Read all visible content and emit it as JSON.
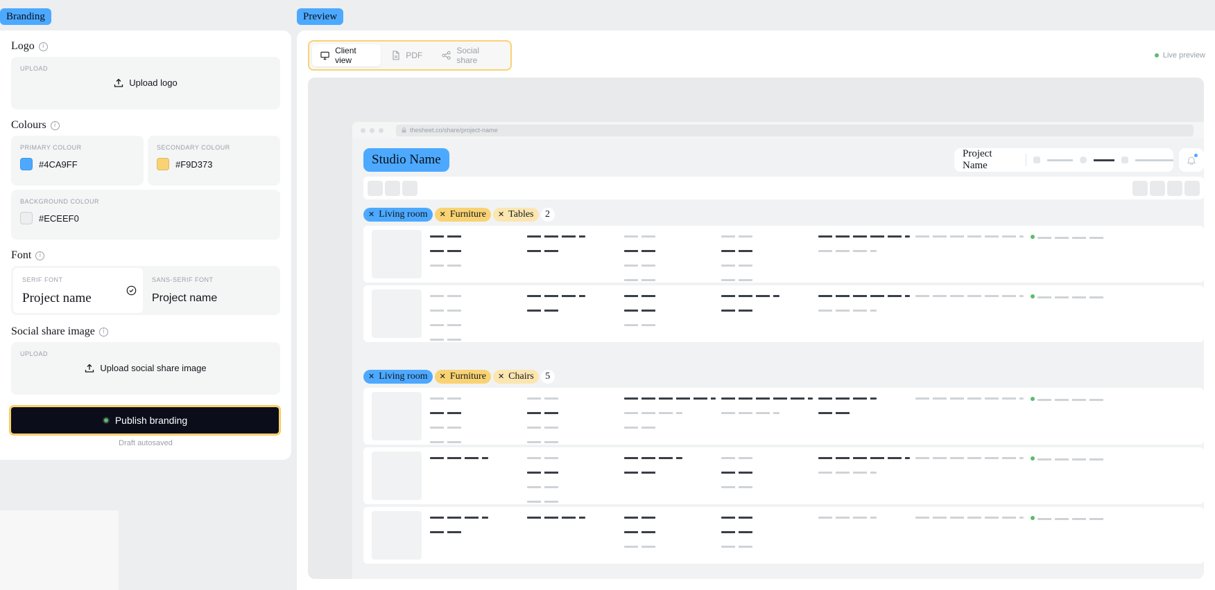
{
  "tags": {
    "branding": "Branding",
    "preview": "Preview"
  },
  "branding": {
    "logo": {
      "label": "Logo",
      "upload_tag": "UPLOAD",
      "upload_button": "Upload logo"
    },
    "colours": {
      "label": "Colours",
      "primary": {
        "label": "PRIMARY COLOUR",
        "value": "#4CA9FF"
      },
      "secondary": {
        "label": "SECONDARY COLOUR",
        "value": "#F9D373"
      },
      "background": {
        "label": "BACKGROUND COLOUR",
        "value": "#ECEEF0"
      }
    },
    "font": {
      "label": "Font",
      "serif": {
        "label": "SERIF FONT",
        "sample": "Project name",
        "selected": true
      },
      "sans": {
        "label": "SANS-SERIF FONT",
        "sample": "Project name",
        "selected": false
      }
    },
    "social": {
      "label": "Social share image",
      "upload_tag": "UPLOAD",
      "upload_button": "Upload social share image"
    },
    "publish_button": "Publish branding",
    "autosave_note": "Draft autosaved"
  },
  "preview": {
    "tabs": [
      {
        "label": "Client view",
        "icon": "monitor-icon",
        "active": true
      },
      {
        "label": "PDF",
        "icon": "document-icon",
        "active": false
      },
      {
        "label": "Social share",
        "icon": "share-icon",
        "active": false
      }
    ],
    "live_label": "Live preview",
    "browser": {
      "url": "thesheet.co/share/project-name",
      "studio_name": "Studio Name",
      "project_name": "Project Name",
      "groups": [
        {
          "chips": [
            "Living room",
            "Furniture",
            "Tables"
          ],
          "count": "2"
        },
        {
          "chips": [
            "Living room",
            "Furniture",
            "Chairs"
          ],
          "count": "5"
        }
      ]
    }
  },
  "colors": {
    "primary": "#4CA9FF",
    "secondary": "#F9D373",
    "background": "#ECEEF0",
    "dark": "#0B0D1A"
  }
}
